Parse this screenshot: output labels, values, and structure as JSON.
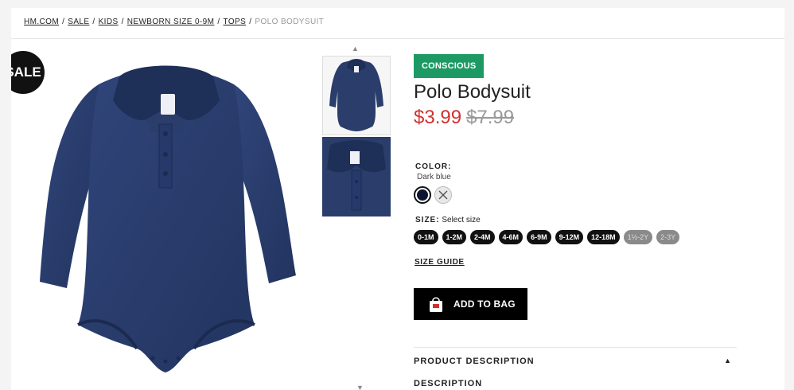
{
  "breadcrumb": {
    "items": [
      "HM.COM",
      "SALE",
      "KIDS",
      "NEWBORN SIZE 0-9M",
      "TOPS"
    ],
    "current": "POLO BODYSUIT",
    "separator": "/"
  },
  "badge": {
    "sale": "SALE"
  },
  "thumbs": {
    "up_icon": "chevron-up-icon",
    "down_icon": "chevron-down-icon"
  },
  "product": {
    "tag": "CONSCIOUS",
    "title": "Polo Bodysuit",
    "price_sale": "$3.99",
    "price_original": "$7.99",
    "color_label": "COLOR:",
    "color_value": "Dark blue",
    "size_label": "SIZE:",
    "size_hint": "Select size",
    "sizes": [
      "0-1M",
      "1-2M",
      "2-4M",
      "4-6M",
      "6-9M",
      "9-12M",
      "12-18M",
      "1½-2Y",
      "2-3Y"
    ],
    "size_guide": "SIZE GUIDE",
    "add_to_bag": "ADD TO BAG",
    "description_header": "PRODUCT DESCRIPTION",
    "description_label": "DESCRIPTION"
  },
  "colors": {
    "sale_price": "#d0312d",
    "conscious_badge": "#1d9a64",
    "garment": "#2a3d6b",
    "swatch_selected": "#0d1430"
  }
}
